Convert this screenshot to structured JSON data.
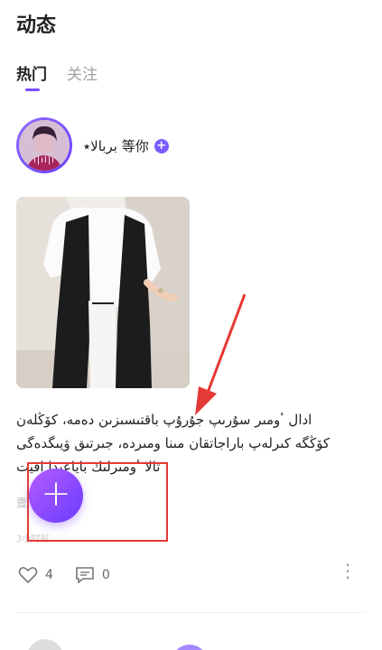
{
  "header": {
    "title": "动态"
  },
  "tabs": [
    {
      "label": "热门",
      "active": true
    },
    {
      "label": "关注",
      "active": false
    }
  ],
  "post": {
    "author": {
      "name": "بربالا٭ 等你",
      "voice_badge": "ı|ıl|ı"
    },
    "text_lines": [
      "ادال ٴومىر سۇرىپ جۇرۇپ باقتىسىزىن دەمە،  كۆڭلەن",
      "كۆڭگە كىرلەپ باراجاتقان مىنا ومىردە، جىرتىق  ۋيىگدەگى",
      "تالا ٴومىرلىك باياعىدا اقيت"
    ],
    "faint_label": "壹",
    "timestamp": "3小时前",
    "likes": "4",
    "comments": "0"
  },
  "icons": {
    "heart": "heart-icon",
    "comment": "comment-icon",
    "more": "more-vertical-icon",
    "fab": "plus-icon"
  },
  "colors": {
    "accent": "#7b4dff",
    "annotation_red": "#e53935"
  }
}
